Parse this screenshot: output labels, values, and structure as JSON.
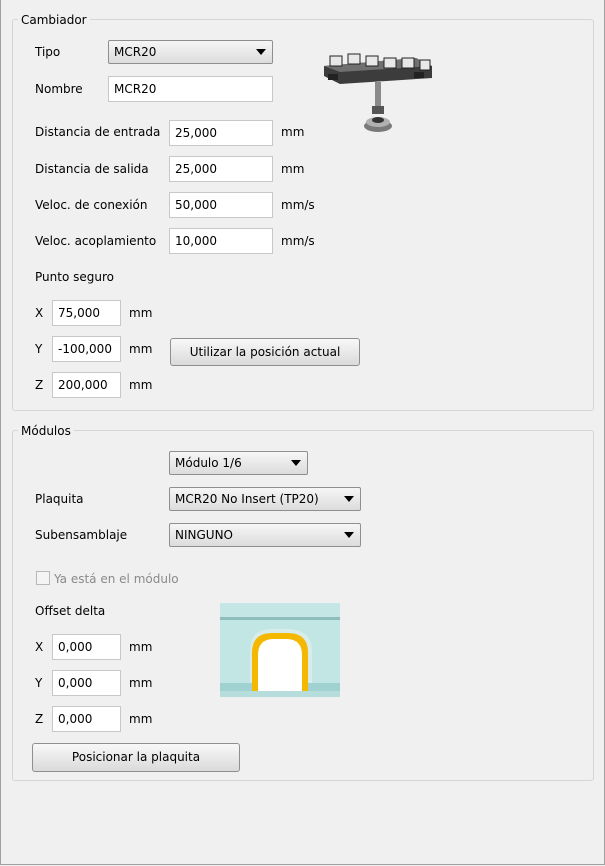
{
  "cambiador": {
    "title": "Cambiador",
    "tipo_label": "Tipo",
    "tipo_value": "MCR20",
    "nombre_label": "Nombre",
    "nombre_value": "MCR20",
    "entrada_label": "Distancia de entrada",
    "entrada_value": "25,000",
    "entrada_unit": "mm",
    "salida_label": "Distancia de salida",
    "salida_value": "25,000",
    "salida_unit": "mm",
    "conexion_label": "Veloc. de conexión",
    "conexion_value": "50,000",
    "conexion_unit": "mm/s",
    "acoplamiento_label": "Veloc. acoplamiento",
    "acoplamiento_value": "10,000",
    "acoplamiento_unit": "mm/s",
    "punto_seguro_label": "Punto seguro",
    "x_label": "X",
    "x_value": "75,000",
    "x_unit": "mm",
    "y_label": "Y",
    "y_value": "-100,000",
    "y_unit": "mm",
    "z_label": "Z",
    "z_value": "200,000",
    "z_unit": "mm",
    "use_position_button": "Utilizar la posición actual"
  },
  "modulos": {
    "title": "Módulos",
    "modulo_value": "Módulo 1/6",
    "plaquita_label": "Plaquita",
    "plaquita_value": "MCR20 No Insert (TP20)",
    "subensamblaje_label": "Subensamblaje",
    "subensamblaje_value": "NINGUNO",
    "ya_esta_label": "Ya está en el módulo",
    "offset_label": "Offset delta",
    "x_label": "X",
    "x_value": "0,000",
    "x_unit": "mm",
    "y_label": "Y",
    "y_value": "0,000",
    "y_unit": "mm",
    "z_label": "Z",
    "z_value": "0,000",
    "z_unit": "mm",
    "position_button": "Posicionar la plaquita"
  },
  "colors": {
    "background": "#f0f0f0",
    "insert_cyan": "#b8e4e2",
    "insert_gold": "#f5b800"
  }
}
